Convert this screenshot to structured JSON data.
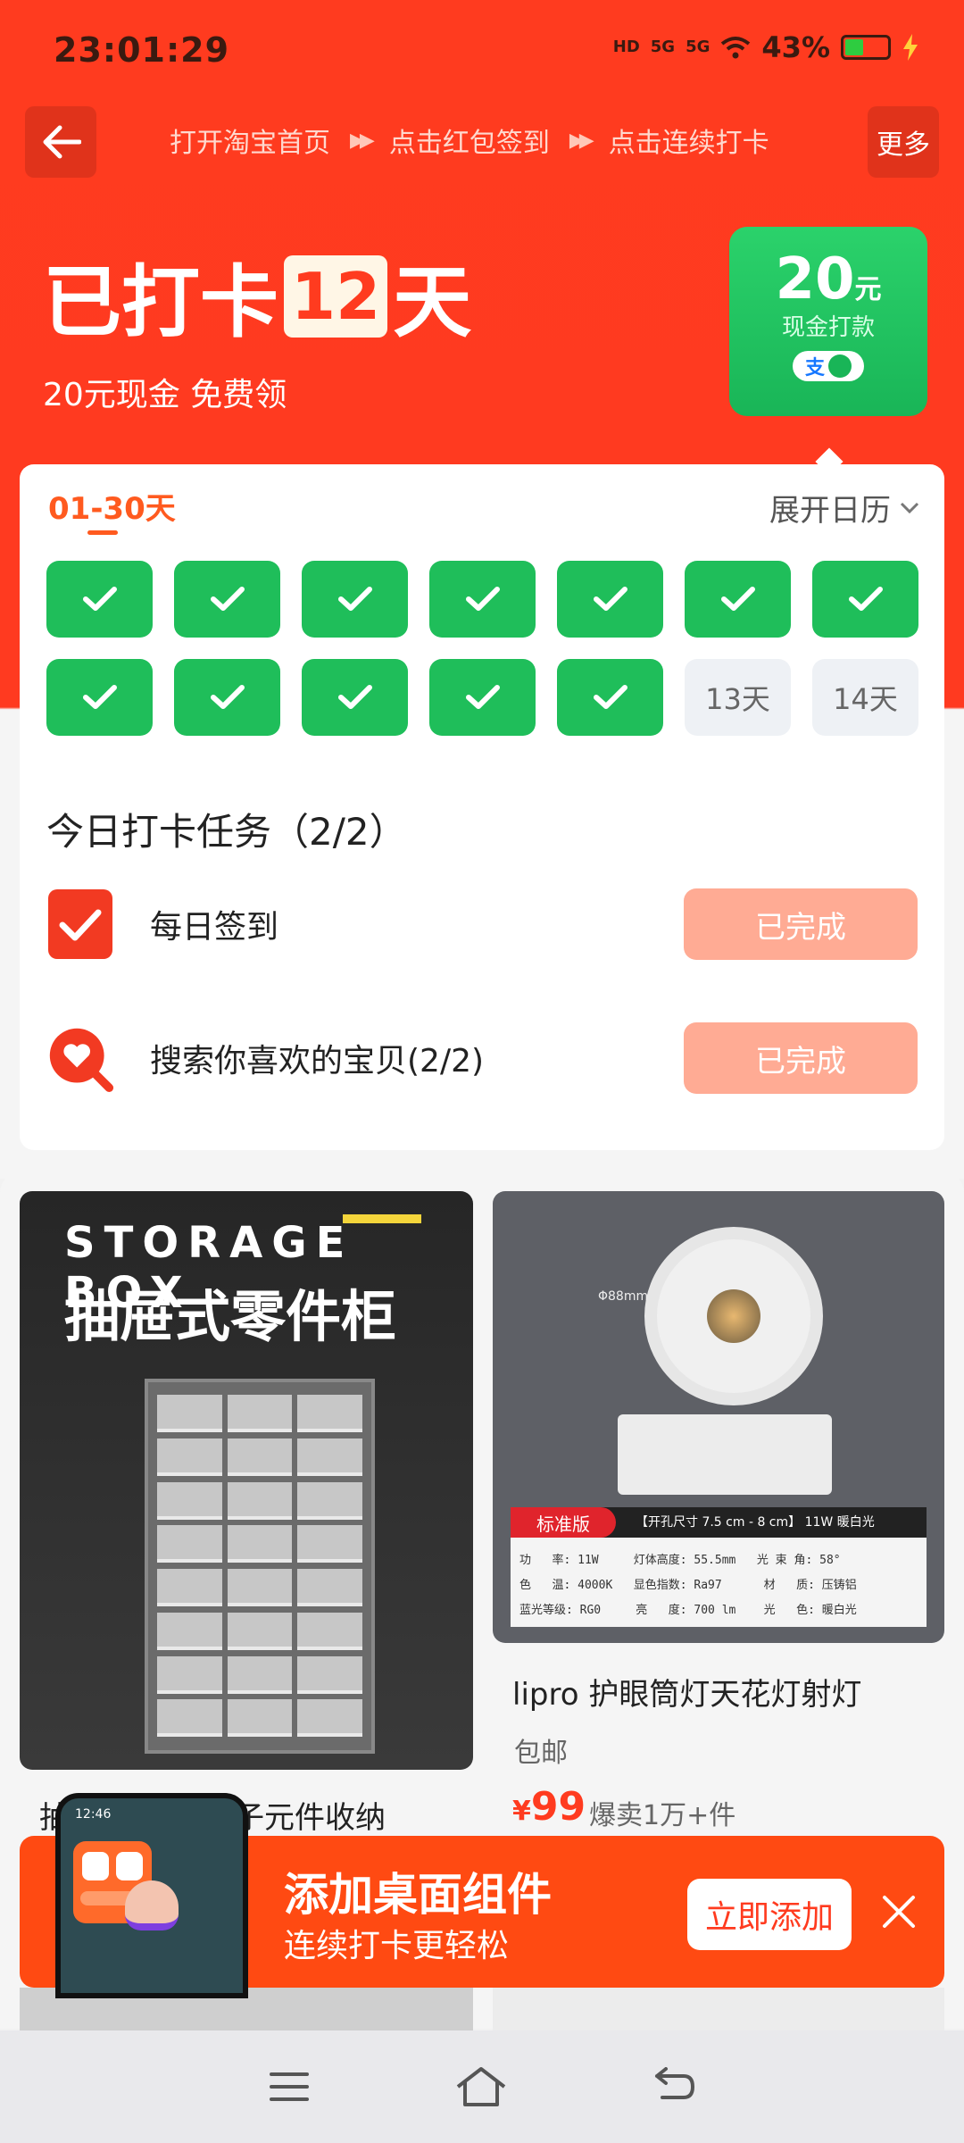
{
  "status": {
    "time": "23:01:29",
    "signal1": "5G",
    "signal2": "5G",
    "hd": "HD",
    "battery": "43%"
  },
  "nav": {
    "back_icon": "back-arrow-icon",
    "steps": [
      "打开淘宝首页",
      "点击红包签到",
      "点击连续打卡"
    ],
    "more_label": "更多"
  },
  "hero": {
    "prefix": "已打卡",
    "days": "12",
    "suffix": "天",
    "subtitle": "20元现金 免费领"
  },
  "cash_card": {
    "amount": "20",
    "unit": "元",
    "label": "现金打款",
    "pay_icon_alipay": "支"
  },
  "calendar": {
    "range_label": "01-30天",
    "expand_label": "展开日历",
    "cells": [
      {
        "state": "done"
      },
      {
        "state": "done"
      },
      {
        "state": "done"
      },
      {
        "state": "done"
      },
      {
        "state": "done"
      },
      {
        "state": "done"
      },
      {
        "state": "done"
      },
      {
        "state": "done"
      },
      {
        "state": "done"
      },
      {
        "state": "done"
      },
      {
        "state": "done"
      },
      {
        "state": "done"
      },
      {
        "state": "todo",
        "label": "13天"
      },
      {
        "state": "todo",
        "label": "14天"
      }
    ]
  },
  "tasks": {
    "title": "今日打卡任务（2/2）",
    "items": [
      {
        "label": "每日签到",
        "button": "已完成",
        "icon": "checkbox-icon"
      },
      {
        "label": "搜索你喜欢的宝贝(2/2)",
        "button": "已完成",
        "icon": "search-heart-icon"
      }
    ]
  },
  "products": {
    "left": {
      "image_head": "STORAGE BOX",
      "image_title": "抽屉式零件柜",
      "title_visible_start": "抽",
      "title_visible_end": "电子元件收纳"
    },
    "right": {
      "spec_tag": "标准版",
      "spec_line": "【开孔尺寸 7.5 cm - 8 cm】 11W 暖白光",
      "spec_rows": "功   率: 11W     灯体高度: 55.5mm   光 束 角: 58°\n色   温: 4000K   显色指数: Ra97      材   质: 压铸铝\n蓝光等级: RG0     亮   度: 700 lm    光   色: 暖白光",
      "dimension": "Φ88mm",
      "title": "lipro 护眼筒灯天花灯射灯",
      "shipping": "包邮",
      "price_symbol": "¥",
      "price": "99",
      "sold": "爆卖1万+件"
    }
  },
  "widget": {
    "title": "添加桌面组件",
    "subtitle": "连续打卡更轻松",
    "add_label": "立即添加",
    "phone_time": "12:46"
  }
}
